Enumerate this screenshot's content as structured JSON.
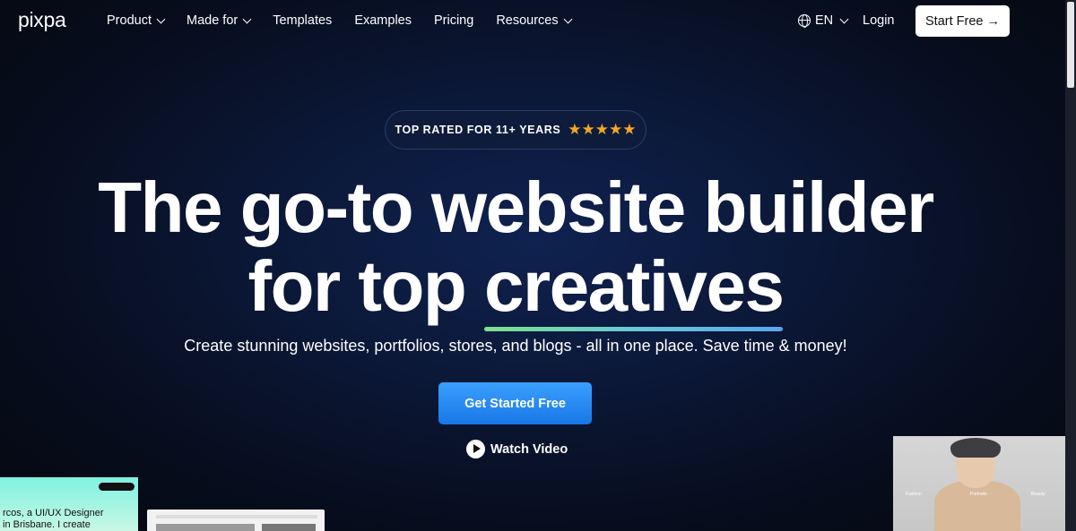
{
  "nav": {
    "logo": "pixpa",
    "items": [
      {
        "label": "Product",
        "dropdown": true
      },
      {
        "label": "Made for",
        "dropdown": true
      },
      {
        "label": "Templates",
        "dropdown": false
      },
      {
        "label": "Examples",
        "dropdown": false
      },
      {
        "label": "Pricing",
        "dropdown": false
      },
      {
        "label": "Resources",
        "dropdown": true
      }
    ],
    "language": "EN",
    "login": "Login",
    "start_free": "Start Free →"
  },
  "hero": {
    "badge_text": "TOP RATED FOR 11+ YEARS",
    "stars": "★★★★★",
    "headline_line1": "The go-to website builder",
    "headline_line2_prefix": "for top ",
    "headline_highlight": "creatives",
    "subtitle": "Create stunning websites, portfolios, stores, and blogs - all in one place. Save time & money!",
    "cta_label": "Get Started Free",
    "watch_label": "Watch Video"
  },
  "previews": {
    "card1_text_line1": "rcos, a UI/UX Designer",
    "card1_text_line2": "in Brisbane. I create",
    "card3_labels": [
      "Fashion",
      "Portraits",
      "Beauty"
    ]
  },
  "colors": {
    "background": "#0b1838",
    "cta": "#1f87f0",
    "stars": "#f5a623",
    "underline_gradient": [
      "#7ee08a",
      "#5aa6ef"
    ]
  },
  "icons": [
    "chevron-down-icon",
    "globe-icon",
    "arrow-right-icon",
    "star-icon",
    "play-icon"
  ]
}
